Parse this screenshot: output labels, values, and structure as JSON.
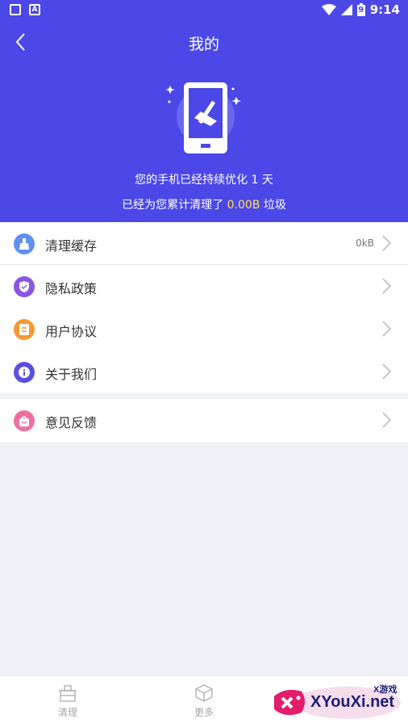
{
  "status": {
    "time": "9:14",
    "battery": "9"
  },
  "header": {
    "title": "我的",
    "optimize_prefix": "您的手机已经持续优化",
    "optimize_days": "1",
    "optimize_unit": "天",
    "cleaned_prefix": "已经为您累计清理了",
    "cleaned_amount": "0.00B",
    "cleaned_suffix": "垃圾"
  },
  "menu": [
    {
      "label": "清理缓存",
      "value": "0kB",
      "icon": "broom-icon",
      "color": "#5f8ff0"
    },
    {
      "label": "隐私政策",
      "icon": "shield-icon",
      "color": "#8a55e6"
    },
    {
      "label": "用户协议",
      "icon": "document-icon",
      "color": "#f29a36"
    },
    {
      "label": "关于我们",
      "icon": "info-icon",
      "color": "#5a4fe0"
    }
  ],
  "feedback": {
    "label": "意见反馈",
    "icon": "bag-icon",
    "color": "#ef6fa0"
  },
  "tabs": [
    {
      "label": "清理",
      "icon": "basket-icon"
    },
    {
      "label": "更多",
      "icon": "cube-icon"
    }
  ],
  "watermark": {
    "main": "XYouXi.net",
    "small": "X游戏"
  }
}
